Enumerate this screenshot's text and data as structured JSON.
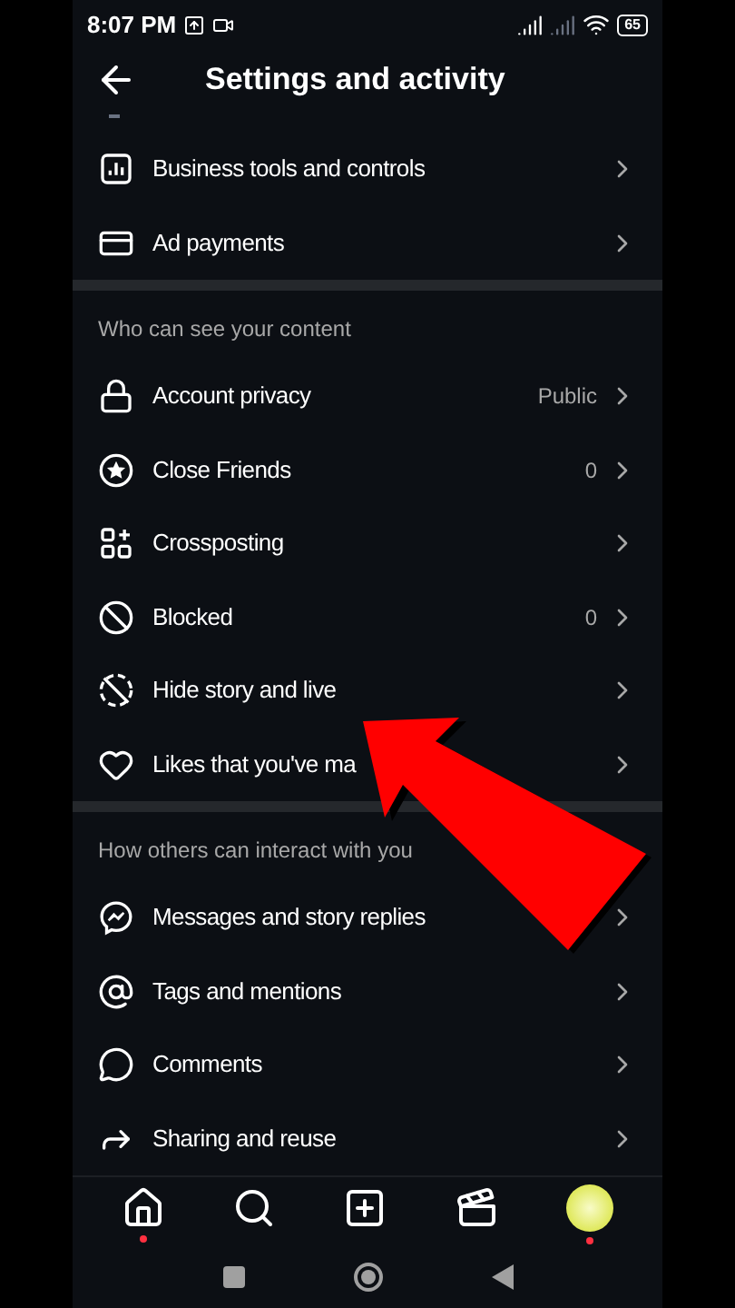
{
  "status_bar": {
    "time": "8:07 PM",
    "battery": "65"
  },
  "header": {
    "title": "Settings and activity"
  },
  "sections": [
    {
      "items": [
        {
          "label": "Business tools and controls"
        },
        {
          "label": "Ad payments"
        }
      ]
    },
    {
      "heading": "Who can see your content",
      "items": [
        {
          "label": "Account privacy",
          "value": "Public"
        },
        {
          "label": "Close Friends",
          "value": "0"
        },
        {
          "label": "Crossposting"
        },
        {
          "label": "Blocked",
          "value": "0"
        },
        {
          "label": "Hide story and live"
        },
        {
          "label": "Likes that you've ma"
        }
      ]
    },
    {
      "heading": "How others can interact with you",
      "items": [
        {
          "label": "Messages and story replies"
        },
        {
          "label": "Tags and mentions"
        },
        {
          "label": "Comments"
        },
        {
          "label": "Sharing and reuse"
        }
      ]
    }
  ],
  "bottom_nav": [
    {
      "notification": true
    },
    {
      "notification": false
    },
    {
      "notification": false
    },
    {
      "notification": false
    },
    {
      "notification": true
    }
  ]
}
